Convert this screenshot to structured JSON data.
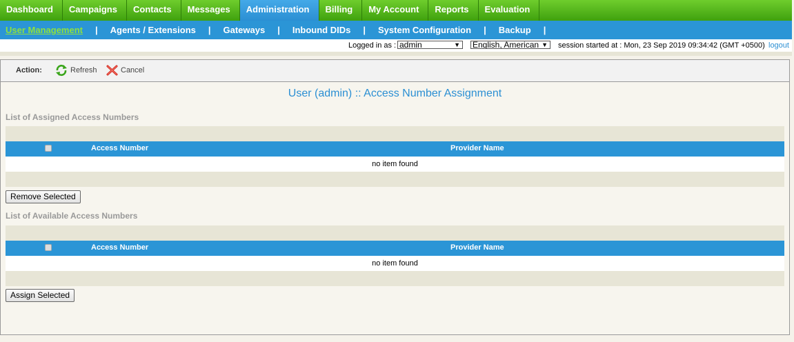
{
  "top_nav": {
    "tabs": [
      {
        "label": "Dashboard",
        "active": false
      },
      {
        "label": "Campaigns",
        "active": false
      },
      {
        "label": "Contacts",
        "active": false
      },
      {
        "label": "Messages",
        "active": false
      },
      {
        "label": "Administration",
        "active": true
      },
      {
        "label": "Billing",
        "active": false
      },
      {
        "label": "My Account",
        "active": false
      },
      {
        "label": "Reports",
        "active": false
      },
      {
        "label": "Evaluation",
        "active": false
      }
    ]
  },
  "sub_nav": {
    "items": [
      {
        "label": "User Management",
        "active": true
      },
      {
        "label": "Agents / Extensions",
        "active": false
      },
      {
        "label": "Gateways",
        "active": false
      },
      {
        "label": "Inbound DIDs",
        "active": false
      },
      {
        "label": "System Configuration",
        "active": false
      },
      {
        "label": "Backup",
        "active": false
      }
    ],
    "separator": "|"
  },
  "session": {
    "logged_in_label": "Logged in as :",
    "user_selected": "admin",
    "language_selected": "English, American",
    "session_text": "session started at : Mon, 23 Sep 2019 09:34:42 (GMT +0500)",
    "logout_label": "logout"
  },
  "actions": {
    "label": "Action:",
    "refresh_label": "Refresh",
    "cancel_label": "Cancel"
  },
  "page": {
    "title": "User (admin) :: Access Number Assignment"
  },
  "assigned": {
    "section_title": "List of Assigned Access Numbers",
    "columns": [
      "Access Number",
      "Provider Name"
    ],
    "empty_text": "no item found",
    "button_label": "Remove Selected"
  },
  "available": {
    "section_title": "List of Available Access Numbers",
    "columns": [
      "Access Number",
      "Provider Name"
    ],
    "empty_text": "no item found",
    "button_label": "Assign Selected"
  },
  "colors": {
    "nav_green": "#4fb81a",
    "nav_blue": "#2b95d6",
    "title_blue": "#2b8fd3"
  }
}
